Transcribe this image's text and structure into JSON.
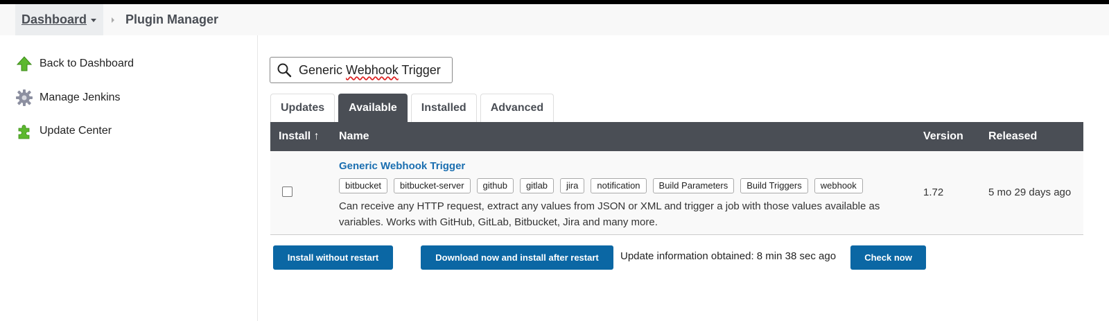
{
  "breadcrumb": {
    "home": "Dashboard",
    "current": "Plugin Manager"
  },
  "sidebar": {
    "items": [
      {
        "label": "Back to Dashboard",
        "icon": "up-arrow-icon"
      },
      {
        "label": "Manage Jenkins",
        "icon": "gear-icon"
      },
      {
        "label": "Update Center",
        "icon": "puzzle-icon"
      }
    ]
  },
  "search": {
    "value_prefix": "Generic ",
    "value_misspelled": "Webhook",
    "value_suffix": " Trigger"
  },
  "tabs": [
    "Updates",
    "Available",
    "Installed",
    "Advanced"
  ],
  "active_tab": "Available",
  "table": {
    "headers": {
      "install": "Install ↑",
      "name": "Name",
      "version": "Version",
      "released": "Released"
    },
    "rows": [
      {
        "name": "Generic Webhook Trigger",
        "labels": [
          "bitbucket",
          "bitbucket-server",
          "github",
          "gitlab",
          "jira",
          "notification",
          "Build Parameters",
          "Build Triggers",
          "webhook"
        ],
        "description_line1": "Can receive any HTTP request, extract any values from JSON or XML and trigger a job with those values available as",
        "description_line2": "variables. Works with GitHub, GitLab, Bitbucket, Jira and many more.",
        "version": "1.72",
        "released": "5 mo 29 days ago",
        "checked": false
      }
    ]
  },
  "actions": {
    "install_without_restart": "Install without restart",
    "download_install_after_restart": "Download now and install after restart",
    "update_info": "Update information obtained: 8 min 38 sec ago",
    "check_now": "Check now"
  },
  "colors": {
    "primary_button": "#0b67a4",
    "header_bg": "#4a4e55",
    "link": "#1a6eb0"
  }
}
